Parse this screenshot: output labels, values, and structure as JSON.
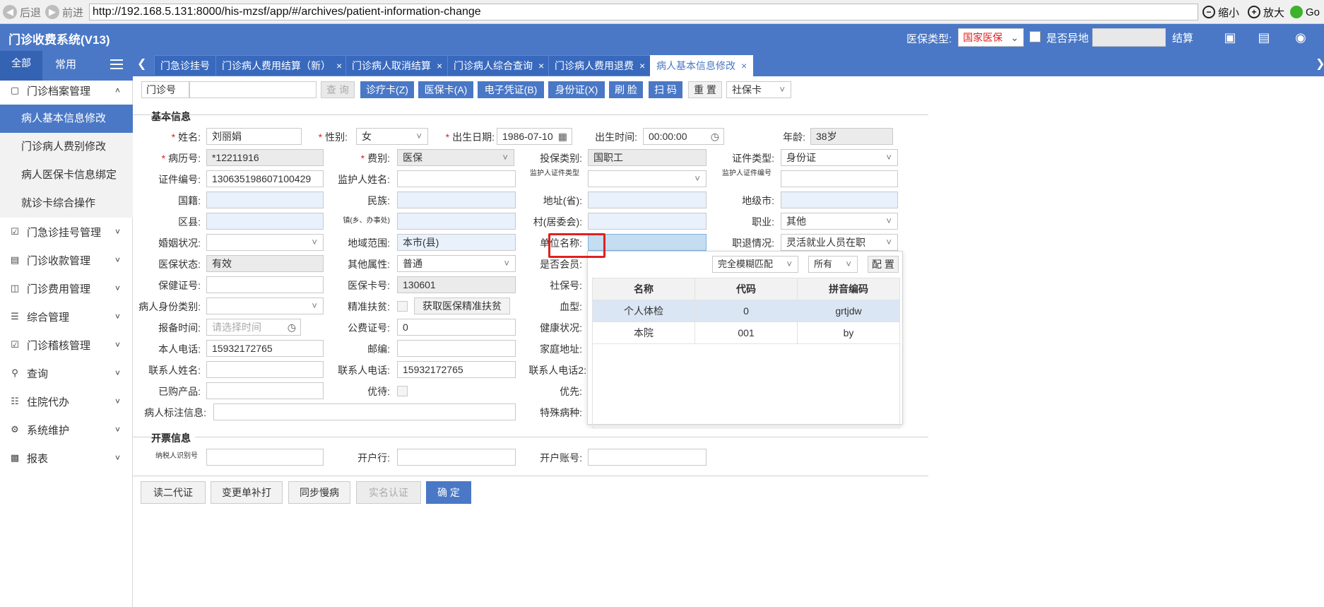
{
  "browser": {
    "back": "后退",
    "forward": "前进",
    "url": "http://192.168.5.131:8000/his-mzsf/app/#/archives/patient-information-change",
    "zoom_out": "缩小",
    "zoom_in": "放大",
    "go": "Go"
  },
  "app": {
    "title": "门诊收费系统(V13)",
    "insurance_type_label": "医保类型:",
    "insurance_type_value": "国家医保",
    "remote_label": "是否异地",
    "settle_label": "结算"
  },
  "sidebar": {
    "tab_all": "全部",
    "tab_common": "常用",
    "groups": [
      {
        "label": "门诊档案管理",
        "icon": "folder-icon",
        "expanded": true,
        "items": [
          {
            "label": "病人基本信息修改",
            "active": true
          },
          {
            "label": "门诊病人费别修改"
          },
          {
            "label": "病人医保卡信息绑定"
          },
          {
            "label": "就诊卡综合操作"
          }
        ]
      },
      {
        "label": "门急诊挂号管理",
        "icon": "clipboard-icon"
      },
      {
        "label": "门诊收款管理",
        "icon": "cash-icon"
      },
      {
        "label": "门诊费用管理",
        "icon": "fee-icon"
      },
      {
        "label": "综合管理",
        "icon": "list-icon"
      },
      {
        "label": "门诊稽核管理",
        "icon": "audit-icon"
      },
      {
        "label": "查询",
        "icon": "search-icon"
      },
      {
        "label": "住院代办",
        "icon": "hospital-icon"
      },
      {
        "label": "系统维护",
        "icon": "wrench-icon"
      },
      {
        "label": "报表",
        "icon": "chart-icon"
      }
    ]
  },
  "tabs": [
    {
      "label": "门急诊挂号",
      "closable": false
    },
    {
      "label": "门诊病人费用结算（新）",
      "closable": true
    },
    {
      "label": "门诊病人取消结算",
      "closable": true
    },
    {
      "label": "门诊病人综合查询",
      "closable": true
    },
    {
      "label": "门诊病人费用退费",
      "closable": true
    },
    {
      "label": "病人基本信息修改",
      "closable": true,
      "active": true
    }
  ],
  "toolbar": {
    "visit_no_label": "门诊号",
    "visit_no_value": "",
    "query": "查 询",
    "card_treat": "诊疗卡(Z)",
    "card_ins": "医保卡(A)",
    "card_ecert": "电子凭证(B)",
    "card_id": "身份证(X)",
    "face": "刷 脸",
    "scan": "扫 码",
    "reset": "重 置",
    "card_type": "社保卡"
  },
  "basic": {
    "section_title": "基本信息",
    "name_label": "姓名:",
    "name": "刘丽娟",
    "sex_label": "性别:",
    "sex": "女",
    "birth_label": "出生日期:",
    "birth": "1986-07-10",
    "birth_time_label": "出生时间:",
    "birth_time": "00:00:00",
    "age_label": "年龄:",
    "age": "38岁",
    "record_no_label": "病历号:",
    "record_no": "*12211916",
    "fee_type_label": "费别:",
    "fee_type": "医保",
    "ins_category_label": "投保类别:",
    "ins_category": "国职工",
    "cert_type_label": "证件类型:",
    "cert_type": "身份证",
    "cert_no_label": "证件编号:",
    "cert_no": "130635198607100429",
    "guardian_name_label": "监护人姓名:",
    "guardian_name": "",
    "guardian_cert_type_label": "监护人证件类型",
    "guardian_cert_type": "",
    "guardian_cert_no_label": "监护人证件编号",
    "guardian_cert_no": "",
    "nationality_label": "国籍:",
    "nationality": "",
    "ethnicity_label": "民族:",
    "ethnicity": "",
    "province_label": "地址(省):",
    "province": "",
    "city_label": "地级市:",
    "city": "",
    "county_label": "区县:",
    "county": "",
    "town_label": "镇(乡、办事处)",
    "town": "",
    "village_label": "村(居委会):",
    "village": "",
    "occupation_label": "职业:",
    "occupation": "其他",
    "marital_label": "婚姻状况:",
    "marital": "",
    "region_label": "地域范围:",
    "region": "本市(县)",
    "employer_label": "单位名称:",
    "employer": "",
    "retire_label": "职退情况:",
    "retire": "灵活就业人员在职",
    "ins_status_label": "医保状态:",
    "ins_status": "有效",
    "other_attr_label": "其他属性:",
    "other_attr": "普通",
    "member_label": "是否会员:",
    "health_no_label": "保健证号:",
    "health_no": "",
    "ins_card_label": "医保卡号:",
    "ins_card": "130601",
    "social_no_label": "社保号:",
    "identity_label": "病人身份类别:",
    "identity": "",
    "poverty_label": "精准扶贫:",
    "poverty_btn": "获取医保精准扶贫",
    "blood_label": "血型:",
    "report_time_label": "报备时间:",
    "report_time_ph": "请选择时间",
    "public_no_label": "公费证号:",
    "public_no": "0",
    "health_status_label": "健康状况:",
    "phone_label": "本人电话:",
    "phone": "15932172765",
    "postcode_label": "邮编:",
    "postcode": "",
    "home_addr_label": "家庭地址:",
    "contact_name_label": "联系人姓名:",
    "contact_name": "",
    "contact_phone_label": "联系人电话:",
    "contact_phone": "15932172765",
    "contact_phone2_label": "联系人电话2:",
    "purchased_label": "已购产品:",
    "purchased": "",
    "vip_label": "优待:",
    "priority_label": "优先:",
    "remark_label": "病人标注信息:",
    "remark": "",
    "special_label": "特殊病种:"
  },
  "invoice": {
    "section_title": "开票信息",
    "taxpayer_label": "纳税人识别号",
    "taxpayer": "",
    "bank_label": "开户行:",
    "bank": "",
    "account_label": "开户账号:",
    "account": ""
  },
  "popup": {
    "match_mode": "完全模糊匹配",
    "scope": "所有",
    "config": "配 置",
    "columns": [
      "名称",
      "代码",
      "拼音编码"
    ],
    "rows": [
      [
        "个人体检",
        "0",
        "grtjdw"
      ],
      [
        "本院",
        "001",
        "by"
      ]
    ]
  },
  "actions": {
    "read_id": "读二代证",
    "change_print": "变更单补打",
    "sync_chronic": "同步慢病",
    "real_name": "实名认证",
    "confirm": "确 定"
  },
  "colors": {
    "brand": "#4a78c6",
    "required": "#e02020",
    "highlight_border": "#e02020"
  }
}
